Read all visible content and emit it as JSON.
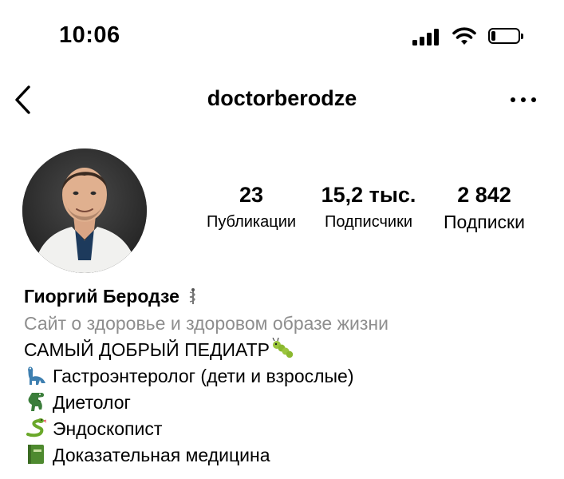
{
  "status_bar": {
    "time": "10:06",
    "battery_level": 0.15,
    "icons": [
      "signal-icon",
      "wifi-icon",
      "battery-icon"
    ]
  },
  "nav": {
    "username": "doctorberodze",
    "icons": [
      "back-icon",
      "more-icon"
    ]
  },
  "profile": {
    "stats": [
      {
        "value": "23",
        "label": "Публикации"
      },
      {
        "value": "15,2 тыс.",
        "label": "Подписчики"
      },
      {
        "value": "2 842",
        "label": "Подписки"
      }
    ]
  },
  "bio": {
    "name": "Гиоргий Беродзе",
    "category": "Сайт о здоровье и здоровом образе жизни",
    "lines": [
      {
        "text": "САМЫЙ ДОБРЫЙ ПЕДИАТР",
        "icon": "caterpillar-icon"
      },
      {
        "text": "Гастроэнтеролог (дети и взрослые)",
        "icon": "dinosaur-icon"
      },
      {
        "text": "Диетолог",
        "icon": "t-rex-icon"
      },
      {
        "text": "Эндоскопист",
        "icon": "snake-icon"
      },
      {
        "text": "Доказательная медицина",
        "icon": "green-book-icon"
      }
    ]
  },
  "colors": {
    "text": "#000000",
    "muted": "#8e8e8e",
    "background": "#ffffff"
  }
}
